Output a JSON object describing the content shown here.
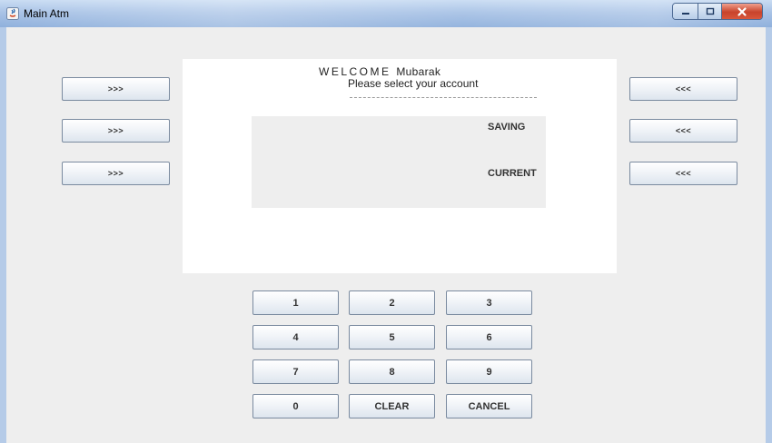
{
  "window": {
    "title": "Main Atm"
  },
  "screen": {
    "welcome_word": "WELCOME",
    "welcome_name": "Mubarak",
    "prompt": "Please select your account",
    "accounts": [
      "SAVING",
      "CURRENT"
    ]
  },
  "left_buttons": [
    ">>>",
    ">>>",
    ">>>"
  ],
  "right_buttons": [
    "<<<",
    "<<<",
    "<<<"
  ],
  "keypad": {
    "rows": [
      [
        "1",
        "2",
        "3"
      ],
      [
        "4",
        "5",
        "6"
      ],
      [
        "7",
        "8",
        "9"
      ],
      [
        "0",
        "CLEAR",
        "CANCEL"
      ]
    ]
  },
  "colors": {
    "background": "#eeeeee",
    "screen": "#ffffff",
    "titlebar": "#a9c3e6",
    "close_button": "#c8432b"
  },
  "icons": [
    "java-app-icon",
    "minimize-icon",
    "maximize-icon",
    "close-icon"
  ]
}
